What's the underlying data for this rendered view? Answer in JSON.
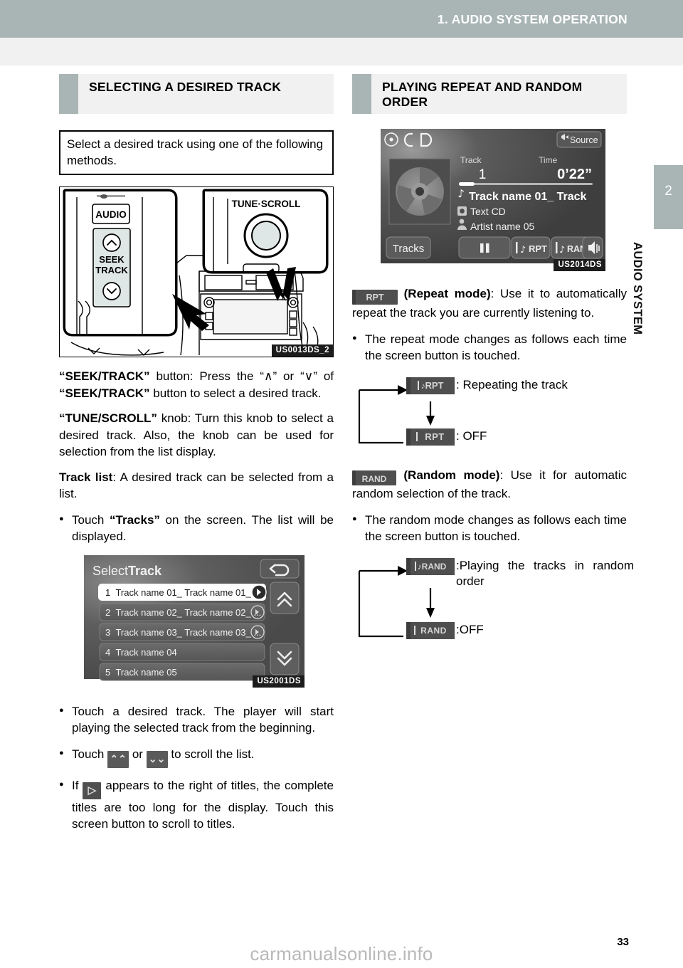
{
  "header": {
    "chapter_title": "1. AUDIO SYSTEM OPERATION"
  },
  "side_tab": {
    "number": "2",
    "label": "AUDIO SYSTEM"
  },
  "left_column": {
    "heading": "SELECTING A DESIRED TRACK",
    "lead_box": "Select a desired track using one of the following methods.",
    "figure1_code": "US0013DS_2",
    "figure1_labels": {
      "audio_button": "AUDIO",
      "seek": "SEEK",
      "track": "TRACK",
      "tune_scroll": "TUNE·SCROLL"
    },
    "para_seek_1": "“SEEK/TRACK”",
    "para_seek_2": " button: Press the “∧” or “∨” of ",
    "para_seek_3": "“SEEK/TRACK”",
    "para_seek_4": " button to select a desired track.",
    "para_tune_1": "“TUNE/SCROLL”",
    "para_tune_2": " knob: Turn this knob to select a desired track. Also, the knob can be used for selection from the list display.",
    "para_list_1": "Track list",
    "para_list_2": ": A desired track can be selected from a list.",
    "bullet_tracks_1": "Touch ",
    "bullet_tracks_2": "“Tracks”",
    "bullet_tracks_3": " on the screen. The list will be displayed.",
    "figure2_code": "US2001DS",
    "track_screen": {
      "title_a": "Select",
      "title_b": "Track",
      "back_icon": "back-arrow-icon",
      "rows": [
        {
          "num": "1",
          "name": "Track name 01_ Track name 01_ T...",
          "has_scroll_btn": true,
          "selected": true
        },
        {
          "num": "2",
          "name": "Track name 02_ Track name 02_ ...",
          "has_scroll_btn": true,
          "selected": false
        },
        {
          "num": "3",
          "name": "Track name 03_ Track name 03_ ...",
          "has_scroll_btn": true,
          "selected": false
        },
        {
          "num": "4",
          "name": "Track name 04",
          "has_scroll_btn": false,
          "selected": false
        },
        {
          "num": "5",
          "name": "Track name 05",
          "has_scroll_btn": false,
          "selected": false
        }
      ],
      "scroll_up": "⌃⌃",
      "scroll_down": "⌄⌄"
    },
    "bullet_touch_track": "Touch a desired track. The player will start playing the selected track from the beginning.",
    "bullet_scroll_1": "Touch ",
    "bullet_scroll_2": " or ",
    "bullet_scroll_3": " to scroll the list.",
    "bullet_longtitle_1": "If ",
    "bullet_longtitle_2": " appears to the right of titles, the complete titles are too long for the display. Touch this screen button to scroll to titles."
  },
  "right_column": {
    "heading": "PLAYING REPEAT AND RANDOM ORDER",
    "figure_code": "US2014DS",
    "cd_screen": {
      "source_label": "Source",
      "cd_label": "CD",
      "track_label": "Track",
      "track_value": "1",
      "time_label": "Time",
      "time_value": "0’22”",
      "track_name": "Track name 01_ Track",
      "disc_type": "Text CD",
      "artist_name": "Artist name 05",
      "tracks_button": "Tracks",
      "pause_button": "pause-icon",
      "rpt_button": "RPT",
      "rand_button": "RAND",
      "volume_button": "speaker-icon"
    },
    "repeat": {
      "chip": "RPT",
      "title": "(Repeat mode)",
      "desc": ": Use it to automatically repeat the track you are currently listening to.",
      "bullet": "The repeat mode changes as follows each time the screen button is touched.",
      "state_on_chip": "RPT",
      "state_on_label": ": Repeating the track",
      "state_off_chip": "RPT",
      "state_off_label": ": OFF"
    },
    "random": {
      "chip": "RAND",
      "title": "(Random mode)",
      "desc": ": Use it for automatic random selection of the track.",
      "bullet": "The random mode changes as follows each time the screen button is touched.",
      "state_on_chip": "RAND",
      "state_on_label": ":Playing the tracks in random order",
      "state_off_chip": "RAND",
      "state_off_label": ":OFF"
    }
  },
  "footer": {
    "page_number": "33",
    "watermark": "carmanualsonline.info"
  }
}
